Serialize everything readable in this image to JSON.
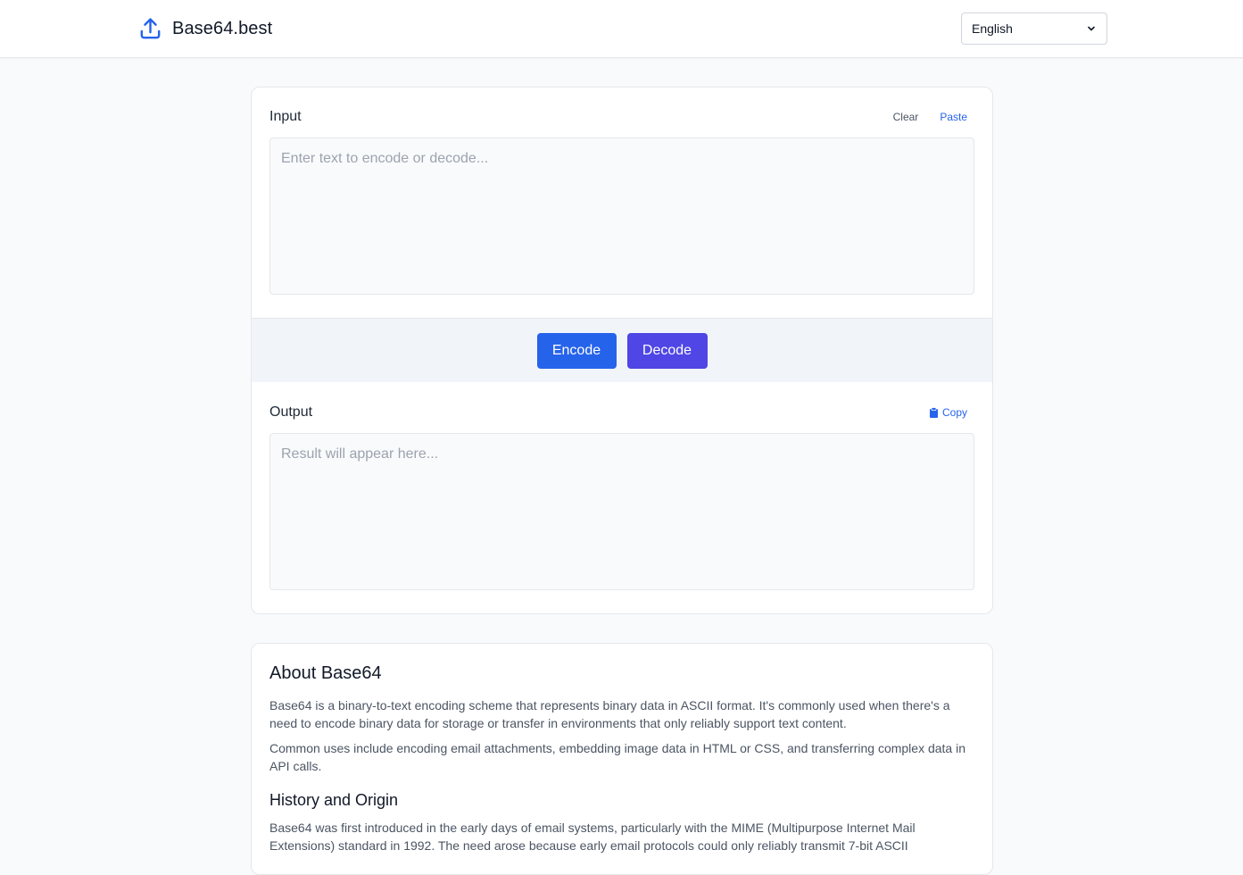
{
  "header": {
    "brand": "Base64.best",
    "language": "English"
  },
  "input": {
    "title": "Input",
    "clear_label": "Clear",
    "paste_label": "Paste",
    "placeholder": "Enter text to encode or decode...",
    "value": ""
  },
  "actions": {
    "encode_label": "Encode",
    "decode_label": "Decode"
  },
  "output": {
    "title": "Output",
    "copy_label": "Copy",
    "placeholder": "Result will appear here...",
    "value": ""
  },
  "about": {
    "heading": "About Base64",
    "p1": "Base64 is a binary-to-text encoding scheme that represents binary data in ASCII format. It's commonly used when there's a need to encode binary data for storage or transfer in environments that only reliably support text content.",
    "p2": "Common uses include encoding email attachments, embedding image data in HTML or CSS, and transferring complex data in API calls.",
    "history_heading": "History and Origin",
    "p3": "Base64 was first introduced in the early days of email systems, particularly with the MIME (Multipurpose Internet Mail Extensions) standard in 1992. The need arose because early email protocols could only reliably transmit 7-bit ASCII"
  },
  "colors": {
    "primary": "#2563eb",
    "secondary": "#4f46e5"
  }
}
